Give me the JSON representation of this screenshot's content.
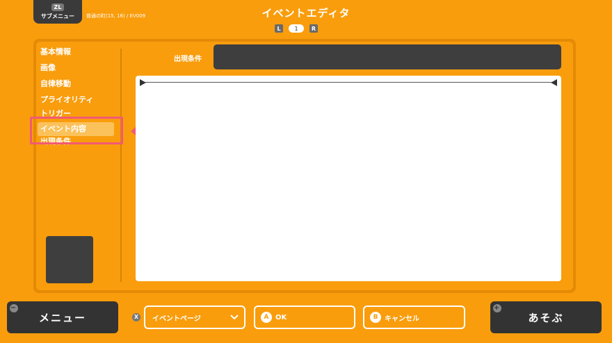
{
  "header": {
    "submenu_key": "ZL",
    "submenu_label": "サブメニュー",
    "location": "普通の町(15, 16) / EV009",
    "title": "イベントエディタ",
    "pager": {
      "left_key": "L",
      "page": "1",
      "right_key": "R"
    }
  },
  "sidebar": {
    "items": [
      {
        "label": "基本情報"
      },
      {
        "label": "画像"
      },
      {
        "label": "自律移動"
      },
      {
        "label": "プライオリティ"
      },
      {
        "label": "トリガー"
      },
      {
        "label": "イベント内容"
      },
      {
        "label": "出現条件"
      }
    ],
    "selected_index": 5
  },
  "main": {
    "condition_label": "出現条件",
    "condition_value": ""
  },
  "footer": {
    "menu_key": "−",
    "menu_label": "メニュー",
    "page_select_key": "X",
    "page_select_label": "イベントページ",
    "ok_key": "A",
    "ok_label": "OK",
    "cancel_key": "B",
    "cancel_label": "キャンセル",
    "play_key": "+",
    "play_label": "あそぶ"
  },
  "colors": {
    "background": "#f99d0d",
    "panel_border": "#e48a05",
    "dark": "#333333",
    "highlight": "#f25a73",
    "selected_item": "#fbc15a"
  }
}
